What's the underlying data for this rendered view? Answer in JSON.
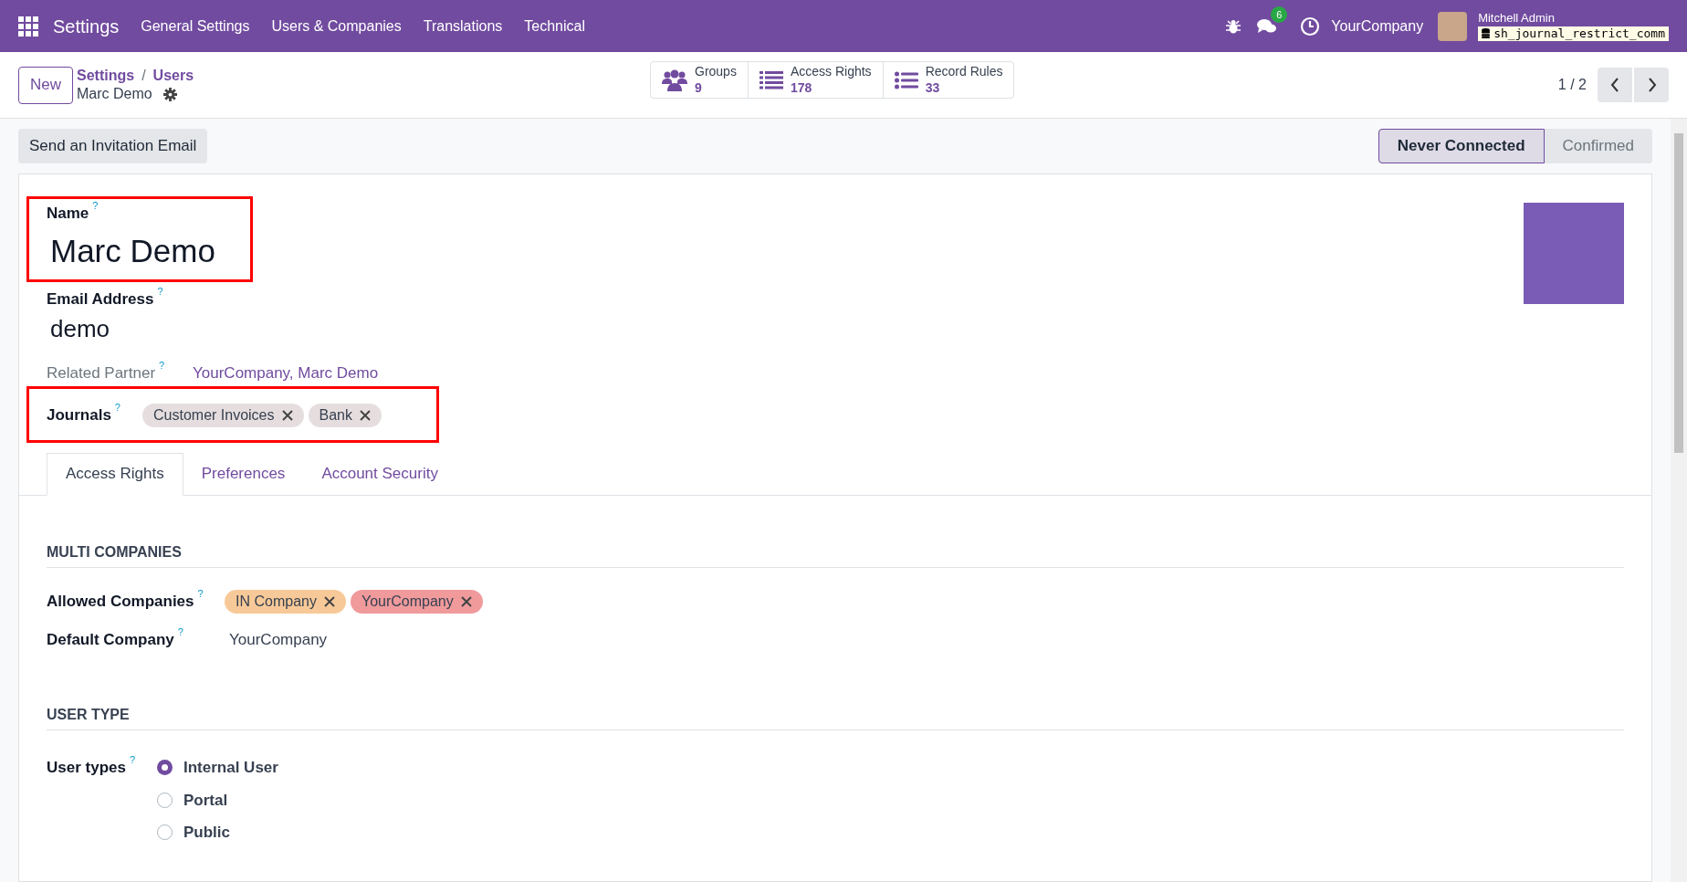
{
  "navbar": {
    "app_name": "Settings",
    "menu": [
      "General Settings",
      "Users & Companies",
      "Translations",
      "Technical"
    ],
    "message_count": "6",
    "company": "YourCompany",
    "user_name": "Mitchell Admin",
    "database": "sh_journal_restrict_comm"
  },
  "control_panel": {
    "new_button": "New",
    "breadcrumbs": [
      "Settings",
      "Users"
    ],
    "breadcrumb_separator": "/",
    "record_title": "Marc Demo",
    "smart_buttons": [
      {
        "kind": "groups",
        "label": "Groups",
        "count": "9"
      },
      {
        "kind": "list",
        "label": "Access Rights",
        "count": "178"
      },
      {
        "kind": "rules",
        "label": "Record Rules",
        "count": "33"
      }
    ],
    "pager": "1 / 2"
  },
  "action_button": "Send an Invitation Email",
  "status_stages": [
    {
      "label": "Never Connected",
      "selected": true
    },
    {
      "label": "Confirmed",
      "selected": false
    }
  ],
  "form": {
    "name_label": "Name",
    "name_help": "?",
    "name": "Marc Demo",
    "email_label": "Email Address",
    "email_help": "?",
    "email": "demo",
    "partner_label": "Related Partner",
    "partner_help": "?",
    "partner": "YourCompany, Marc Demo",
    "journals_label": "Journals",
    "journals_help": "?",
    "journals": [
      {
        "label": "Customer Invoices",
        "color": "#e6dede"
      },
      {
        "label": "Bank",
        "color": "#e6dede"
      }
    ]
  },
  "tabs": [
    {
      "label": "Access Rights",
      "selected": true
    },
    {
      "label": "Preferences",
      "selected": false
    },
    {
      "label": "Account Security",
      "selected": false
    }
  ],
  "multi_companies": {
    "heading": "MULTI COMPANIES",
    "allowed_label": "Allowed Companies",
    "allowed_help": "?",
    "allowed": [
      {
        "label": "IN Company",
        "color": "#f8c998"
      },
      {
        "label": "YourCompany",
        "color": "#f09a9c"
      }
    ],
    "default_label": "Default Company",
    "default_help": "?",
    "default": "YourCompany"
  },
  "user_type": {
    "heading": "USER TYPE",
    "label": "User types",
    "help": "?",
    "options": [
      {
        "label": "Internal User",
        "selected": true
      },
      {
        "label": "Portal",
        "selected": false
      },
      {
        "label": "Public",
        "selected": false
      }
    ]
  }
}
